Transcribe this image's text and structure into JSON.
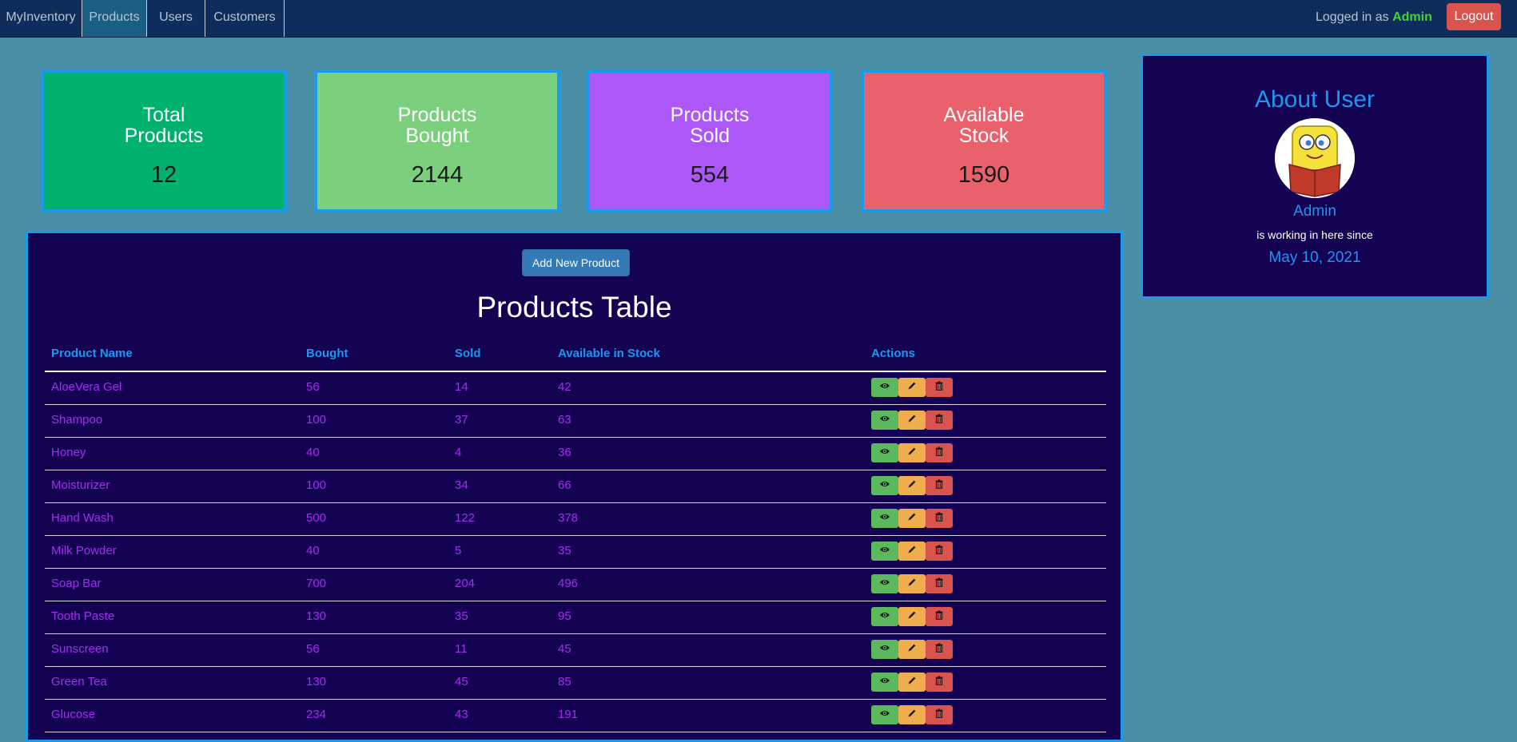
{
  "navbar": {
    "brand": "MyInventory",
    "items": [
      "Products",
      "Users",
      "Customers"
    ],
    "logged_in_prefix": "Logged in as ",
    "user": "Admin",
    "logout": "Logout"
  },
  "stats": [
    {
      "title": "Total\nProducts",
      "value": "12"
    },
    {
      "title": "Products\nBought",
      "value": "2144"
    },
    {
      "title": "Products\nSold",
      "value": "554"
    },
    {
      "title": "Available\nStock",
      "value": "1590"
    }
  ],
  "about": {
    "title": "About User",
    "name": "Admin",
    "since_text": "is working in here since",
    "date": "May 10, 2021"
  },
  "products": {
    "add_button": "Add New Product",
    "title": "Products Table",
    "columns": [
      "Product Name",
      "Bought",
      "Sold",
      "Available in Stock",
      "Actions"
    ],
    "rows": [
      [
        "AloeVera Gel",
        "56",
        "14",
        "42"
      ],
      [
        "Shampoo",
        "100",
        "37",
        "63"
      ],
      [
        "Honey",
        "40",
        "4",
        "36"
      ],
      [
        "Moisturizer",
        "100",
        "34",
        "66"
      ],
      [
        "Hand Wash",
        "500",
        "122",
        "378"
      ],
      [
        "Milk Powder",
        "40",
        "5",
        "35"
      ],
      [
        "Soap Bar",
        "700",
        "204",
        "496"
      ],
      [
        "Tooth Paste",
        "130",
        "35",
        "95"
      ],
      [
        "Sunscreen",
        "56",
        "11",
        "45"
      ],
      [
        "Green Tea",
        "130",
        "45",
        "85"
      ],
      [
        "Glucose",
        "234",
        "43",
        "191"
      ]
    ]
  },
  "icons": {
    "view": "eye-icon",
    "edit": "pencil-icon",
    "delete": "trash-icon"
  },
  "colors": {
    "background": "#4b8fa6",
    "navbar": "#0e2d5a",
    "panel": "#140353",
    "accent_blue": "#1b97f0",
    "row_text": "#a42df0",
    "total_card": "#00b26e",
    "bought_card": "#7ccf7c",
    "sold_card": "#ae57f8",
    "stock_card": "#ea616b"
  }
}
